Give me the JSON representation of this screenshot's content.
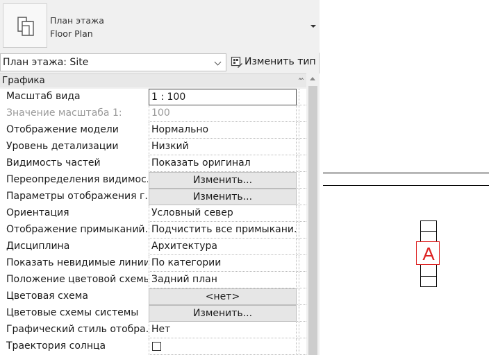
{
  "type_selector": {
    "name_line1": "План этажа",
    "name_line2": "Floor Plan",
    "icon": "floor-plan-icon"
  },
  "instance": {
    "selected": "План этажа: Site",
    "edit_type_label": "Изменить тип",
    "edit_type_icon": "edit-type-icon"
  },
  "section": {
    "title": "Графика"
  },
  "properties": [
    {
      "name": "Масштаб вида",
      "value": "1 : 100",
      "kind": "edit"
    },
    {
      "name": "Значение масштаба    1:",
      "value": "100",
      "kind": "disabled"
    },
    {
      "name": "Отображение модели",
      "value": "Нормально",
      "kind": "text"
    },
    {
      "name": "Уровень детализации",
      "value": "Низкий",
      "kind": "text"
    },
    {
      "name": "Видимость частей",
      "value": "Показать оригинал",
      "kind": "text"
    },
    {
      "name": "Переопределения видимос...",
      "value": "Изменить...",
      "kind": "button"
    },
    {
      "name": "Параметры отображения г...",
      "value": "Изменить...",
      "kind": "button"
    },
    {
      "name": "Ориентация",
      "value": "Условный север",
      "kind": "text"
    },
    {
      "name": "Отображение примыканий...",
      "value": "Подчистить все примыкани...",
      "kind": "text"
    },
    {
      "name": "Дисциплина",
      "value": "Архитектура",
      "kind": "text"
    },
    {
      "name": "Показать невидимые линии",
      "value": "По категории",
      "kind": "text"
    },
    {
      "name": "Положение цветовой схемы",
      "value": "Задний план",
      "kind": "text"
    },
    {
      "name": "Цветовая схема",
      "value": "<нет>",
      "kind": "button"
    },
    {
      "name": "Цветовые схемы системы",
      "value": "Изменить...",
      "kind": "button"
    },
    {
      "name": "Графический стиль отобра...",
      "value": "Нет",
      "kind": "text"
    },
    {
      "name": "Траектория солнца",
      "value": "",
      "kind": "checkbox"
    }
  ],
  "canvas": {
    "marker_label": "A",
    "marker_color": "#dd2222"
  }
}
